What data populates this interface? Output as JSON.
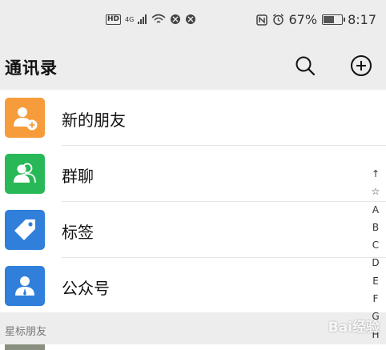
{
  "status": {
    "hd": "HD",
    "net": "4G",
    "battery_text": "67%",
    "time": "8:17",
    "battery_level": 0.67
  },
  "header": {
    "title": "通讯录",
    "search_icon": "search-icon",
    "add_icon": "plus-circle-icon"
  },
  "items": [
    {
      "label": "新的朋友",
      "icon": "add-friend-icon",
      "color": "#f79c3b"
    },
    {
      "label": "群聊",
      "icon": "group-icon",
      "color": "#29b858"
    },
    {
      "label": "标签",
      "icon": "tag-icon",
      "color": "#2f7fdb"
    },
    {
      "label": "公众号",
      "icon": "official-account-icon",
      "color": "#2f7fdb"
    }
  ],
  "section": {
    "starred": "星标朋友"
  },
  "alphabet": [
    "↑",
    "☆",
    "A",
    "B",
    "C",
    "D",
    "E",
    "F",
    "G",
    "H"
  ],
  "watermark": "Bai经验"
}
